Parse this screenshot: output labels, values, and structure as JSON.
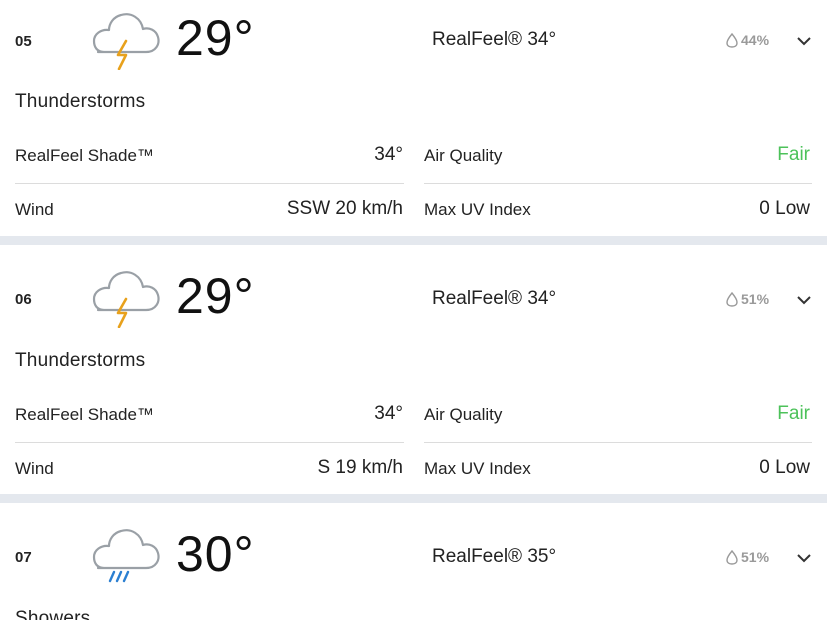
{
  "forecasts": [
    {
      "hour": "05",
      "icon": "thunderstorm-icon",
      "temp": "29°",
      "realfeel": "RealFeel® 34°",
      "precip": "44%",
      "phrase": "Thunderstorms",
      "realfeel_shade_label": "RealFeel Shade™",
      "realfeel_shade_value": "34°",
      "air_quality_label": "Air Quality",
      "air_quality_value": "Fair",
      "wind_label": "Wind",
      "wind_value": "SSW 20 km/h",
      "uv_label": "Max UV Index",
      "uv_value": "0 Low"
    },
    {
      "hour": "06",
      "icon": "thunderstorm-icon",
      "temp": "29°",
      "realfeel": "RealFeel® 34°",
      "precip": "51%",
      "phrase": "Thunderstorms",
      "realfeel_shade_label": "RealFeel Shade™",
      "realfeel_shade_value": "34°",
      "air_quality_label": "Air Quality",
      "air_quality_value": "Fair",
      "wind_label": "Wind",
      "wind_value": "S 19 km/h",
      "uv_label": "Max UV Index",
      "uv_value": "0 Low"
    },
    {
      "hour": "07",
      "icon": "showers-icon",
      "temp": "30°",
      "realfeel": "RealFeel® 35°",
      "precip": "51%",
      "phrase": "Showers"
    }
  ],
  "colors": {
    "fair": "#4cc25a",
    "lightning": "#e8a11c",
    "rain": "#2b7fd1",
    "separator": "#e4e8ee"
  }
}
